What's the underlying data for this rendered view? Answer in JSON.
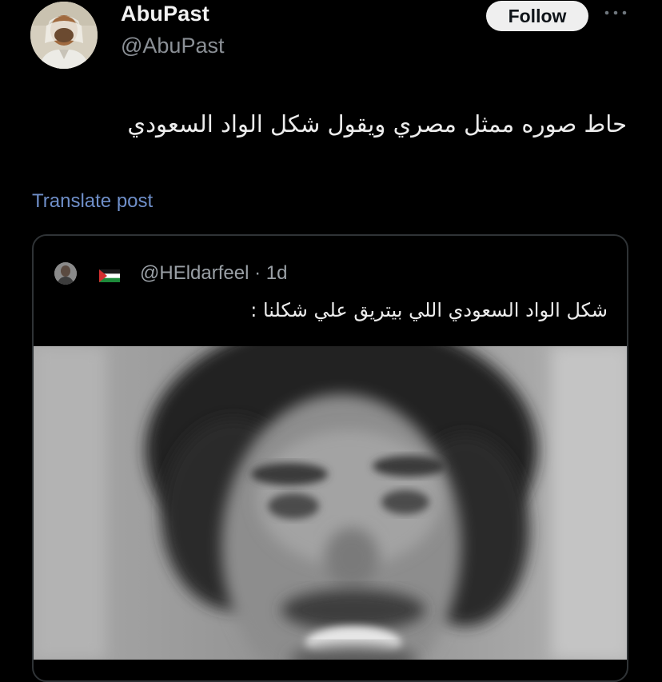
{
  "author": {
    "display_name": "AbuPast",
    "handle": "@AbuPast"
  },
  "follow_label": "Follow",
  "more_icon": "more-icon",
  "tweet_text": "حاط صوره ممثل مصري ويقول شكل الواد السعودي",
  "translate_label": "Translate post",
  "quoted": {
    "handle_line": "@HEldarfeel · 1d",
    "flag_icon": "palestine-flag-icon",
    "text": "شكل الواد السعودي اللي بيتريق علي شكلنا :"
  },
  "colors": {
    "background": "#000000",
    "link": "#6f8fc9",
    "muted": "#8b9096",
    "follow_bg": "#efefef"
  }
}
